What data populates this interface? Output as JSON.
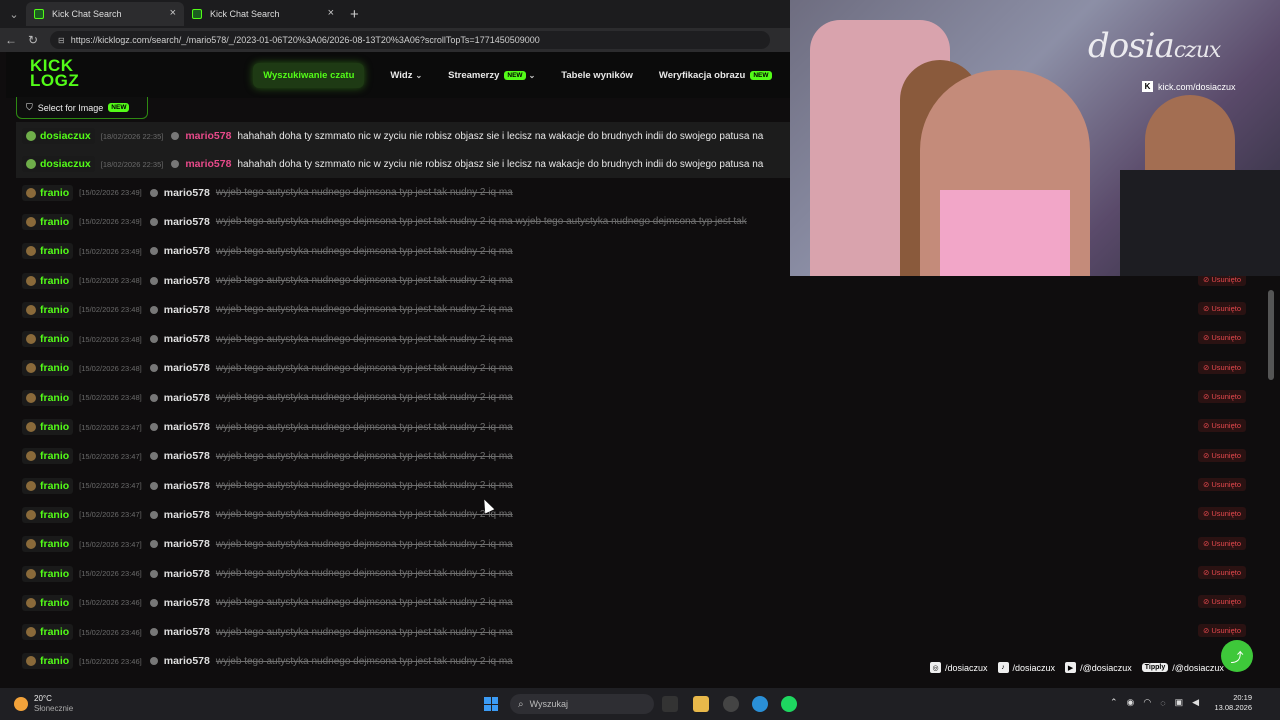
{
  "browser": {
    "tabs": [
      {
        "title": "Kick Chat Search",
        "active": true
      },
      {
        "title": "Kick Chat Search",
        "active": false
      }
    ],
    "url": "https://kicklogz.com/search/_/mario578/_/2023-01-06T20%3A06/2026-08-13T20%3A06?scrollTopTs=1771450509000"
  },
  "site": {
    "logo_line1": "KICK",
    "logo_line2": "LOGZ",
    "nav": [
      {
        "label": "Wyszukiwanie czatu",
        "active": true
      },
      {
        "label": "Widz",
        "dropdown": true
      },
      {
        "label": "Streamerzy",
        "badge": "NEW",
        "dropdown": true
      },
      {
        "label": "Tabele wyników"
      },
      {
        "label": "Weryfikacja obrazu",
        "badge": "NEW"
      }
    ],
    "select_for_image": "Select for Image",
    "select_badge": "NEW",
    "accent": "#53fc18"
  },
  "chat": {
    "removed_label": "Usunięto",
    "rows": [
      {
        "user": "dosiaczux",
        "user_color": "#53fc18",
        "ts": "[18/02/2026 22:35]",
        "recipient": "mario578",
        "recipient_color": "#e84a8a",
        "msg": "hahahah doha ty szmmato nic w zyciu nie robisz objasz sie i lecisz na wakacje do brudnych indii do swojego patusa na",
        "deleted": false,
        "hl": true
      },
      {
        "user": "dosiaczux",
        "user_color": "#53fc18",
        "ts": "[18/02/2026 22:35]",
        "recipient": "mario578",
        "recipient_color": "#e84a8a",
        "msg": "hahahah doha ty szmmato nic w zyciu nie robisz objasz sie i lecisz na wakacje do brudnych indii do swojego patusa na",
        "deleted": false,
        "hl": true
      },
      {
        "user": "franio",
        "user_color": "#53fc18",
        "ts": "[15/02/2026 23:49]",
        "recipient": "mario578",
        "recipient_color": "#e0e0e0",
        "msg": "wyjeb tego autystyka nudnego dejmsona typ jest tak nudny 2 iq ma",
        "deleted": true
      },
      {
        "user": "franio",
        "user_color": "#53fc18",
        "ts": "[15/02/2026 23:49]",
        "recipient": "mario578",
        "recipient_color": "#e0e0e0",
        "msg": "wyjeb tego autystyka nudnego dejmsona typ jest tak nudny 2 iq ma wyjeb tego autystyka nudnego dejmsona typ jest tak",
        "deleted": true
      },
      {
        "user": "franio",
        "user_color": "#53fc18",
        "ts": "[15/02/2026 23:49]",
        "recipient": "mario578",
        "recipient_color": "#e0e0e0",
        "msg": "wyjeb tego autystyka nudnego dejmsona typ jest tak nudny 2 iq ma",
        "deleted": true
      },
      {
        "user": "franio",
        "user_color": "#53fc18",
        "ts": "[15/02/2026 23:48]",
        "recipient": "mario578",
        "recipient_color": "#e0e0e0",
        "msg": "wyjeb tego autystyka nudnego dejmsona typ jest tak nudny 2 iq ma",
        "deleted": true,
        "removed": true
      },
      {
        "user": "franio",
        "user_color": "#53fc18",
        "ts": "[15/02/2026 23:48]",
        "recipient": "mario578",
        "recipient_color": "#e0e0e0",
        "msg": "wyjeb tego autystyka nudnego dejmsona typ jest tak nudny 2 iq ma",
        "deleted": true,
        "removed": true
      },
      {
        "user": "franio",
        "user_color": "#53fc18",
        "ts": "[15/02/2026 23:48]",
        "recipient": "mario578",
        "recipient_color": "#e0e0e0",
        "msg": "wyjeb tego autystyka nudnego dejmsona typ jest tak nudny 2 iq ma",
        "deleted": true,
        "removed": true
      },
      {
        "user": "franio",
        "user_color": "#53fc18",
        "ts": "[15/02/2026 23:48]",
        "recipient": "mario578",
        "recipient_color": "#e0e0e0",
        "msg": "wyjeb tego autystyka nudnego dejmsona typ jest tak nudny 2 iq ma",
        "deleted": true,
        "removed": true
      },
      {
        "user": "franio",
        "user_color": "#53fc18",
        "ts": "[15/02/2026 23:48]",
        "recipient": "mario578",
        "recipient_color": "#e0e0e0",
        "msg": "wyjeb tego autystyka nudnego dejmsona typ jest tak nudny 2 iq ma",
        "deleted": true,
        "removed": true
      },
      {
        "user": "franio",
        "user_color": "#53fc18",
        "ts": "[15/02/2026 23:47]",
        "recipient": "mario578",
        "recipient_color": "#e0e0e0",
        "msg": "wyjeb tego autystyka nudnego dejmsona typ jest tak nudny 2 iq ma",
        "deleted": true,
        "removed": true
      },
      {
        "user": "franio",
        "user_color": "#53fc18",
        "ts": "[15/02/2026 23:47]",
        "recipient": "mario578",
        "recipient_color": "#e0e0e0",
        "msg": "wyjeb tego autystyka nudnego dejmsona typ jest tak nudny 2 iq ma",
        "deleted": true,
        "removed": true
      },
      {
        "user": "franio",
        "user_color": "#53fc18",
        "ts": "[15/02/2026 23:47]",
        "recipient": "mario578",
        "recipient_color": "#e0e0e0",
        "msg": "wyjeb tego autystyka nudnego dejmsona typ jest tak nudny 2 iq ma",
        "deleted": true,
        "removed": true
      },
      {
        "user": "franio",
        "user_color": "#53fc18",
        "ts": "[15/02/2026 23:47]",
        "recipient": "mario578",
        "recipient_color": "#e0e0e0",
        "msg": "wyjeb tego autystyka nudnego dejmsona typ jest tak nudny 2 iq ma",
        "deleted": true,
        "removed": true
      },
      {
        "user": "franio",
        "user_color": "#53fc18",
        "ts": "[15/02/2026 23:47]",
        "recipient": "mario578",
        "recipient_color": "#e0e0e0",
        "msg": "wyjeb tego autystyka nudnego dejmsona typ jest tak nudny 2 iq ma",
        "deleted": true,
        "removed": true
      },
      {
        "user": "franio",
        "user_color": "#53fc18",
        "ts": "[15/02/2026 23:46]",
        "recipient": "mario578",
        "recipient_color": "#e0e0e0",
        "msg": "wyjeb tego autystyka nudnego dejmsona typ jest tak nudny 2 iq ma",
        "deleted": true,
        "removed": true
      },
      {
        "user": "franio",
        "user_color": "#53fc18",
        "ts": "[15/02/2026 23:46]",
        "recipient": "mario578",
        "recipient_color": "#e0e0e0",
        "msg": "wyjeb tego autystyka nudnego dejmsona typ jest tak nudny 2 iq ma",
        "deleted": true,
        "removed": true
      },
      {
        "user": "franio",
        "user_color": "#53fc18",
        "ts": "[15/02/2026 23:46]",
        "recipient": "mario578",
        "recipient_color": "#e0e0e0",
        "msg": "wyjeb tego autystyka nudnego dejmsona typ jest tak nudny 2 iq ma",
        "deleted": true,
        "removed": true
      },
      {
        "user": "franio",
        "user_color": "#53fc18",
        "ts": "[15/02/2026 23:46]",
        "recipient": "mario578",
        "recipient_color": "#e0e0e0",
        "msg": "wyjeb tego autystyka nudnego dejmsona typ jest tak nudny 2 iq ma",
        "deleted": true
      }
    ]
  },
  "webcam": {
    "brand_main": "dosia",
    "brand_sub": "czux",
    "kick_link": "kick.com/dosiaczux"
  },
  "socials": [
    {
      "icon": "instagram-icon",
      "glyph": "◎",
      "label": "/dosiaczux"
    },
    {
      "icon": "tiktok-icon",
      "glyph": "♪",
      "label": "/dosiaczux"
    },
    {
      "icon": "youtube-icon",
      "glyph": "▶",
      "label": "/@dosiaczux"
    },
    {
      "icon": "tipply-icon",
      "glyph": "Tipply",
      "label": "/@dosiaczux",
      "badge": true
    }
  ],
  "taskbar": {
    "weather_temp": "20°C",
    "weather_desc": "Słonecznie",
    "search_placeholder": "Wyszukaj",
    "time": "20:19",
    "date": "13.08.2026"
  }
}
